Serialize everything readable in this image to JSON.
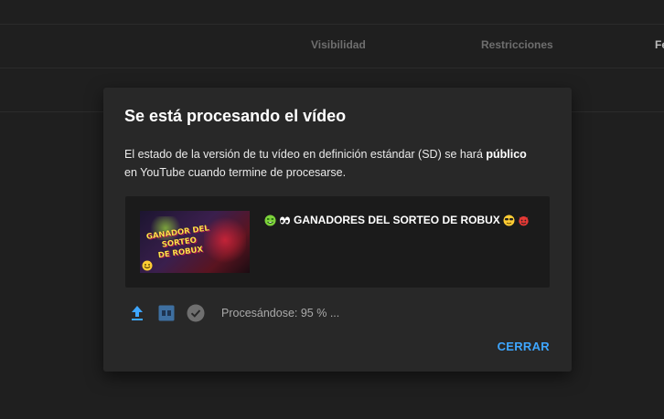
{
  "table_header": {
    "visibility": "Visibilidad",
    "restrictions": "Restricciones",
    "date_partial": "Fe"
  },
  "dialog": {
    "title": "Se está procesando el vídeo",
    "body_part1": "El estado de la versión de tu vídeo en definición estándar (SD) se hará ",
    "body_bold": "público",
    "body_part2": "en YouTube cuando termine de procesarse.",
    "video": {
      "title": "GANADORES DEL SORTEO DE ROBUX",
      "thumbnail_text_line1": "GANADOR DEL SORTEO",
      "thumbnail_text_line2": "DE ROBUX",
      "title_emojis": [
        "money-mouth-face-icon",
        "eyes-icon",
        "sunglasses-face-icon",
        "devil-face-icon"
      ]
    },
    "status": {
      "icons": [
        "upload-icon",
        "sd-icon",
        "check-circle-icon"
      ],
      "text": "Procesándose: 95 % ..."
    },
    "close_label": "CERRAR"
  },
  "colors": {
    "background": "#1f1f1f",
    "dialog": "#282828",
    "card": "#1b1b1b",
    "accent": "#3ea6ff"
  }
}
